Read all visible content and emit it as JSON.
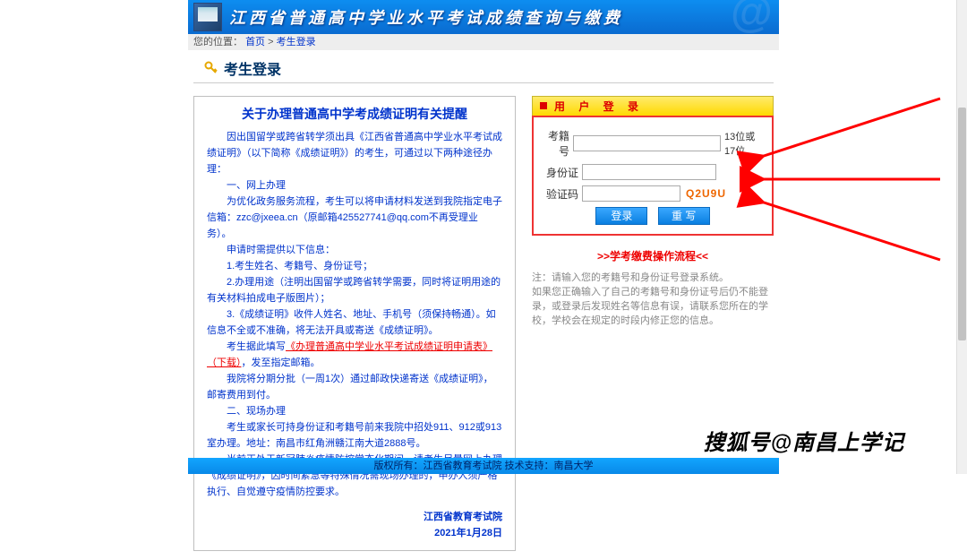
{
  "banner": {
    "title": "江西省普通高中学业水平考试成绩查询与缴费"
  },
  "breadcrumb": {
    "label": "您的位置：",
    "home": "首页",
    "sep": " > ",
    "current": "考生登录"
  },
  "page_title": "考生登录",
  "notice": {
    "heading": "关于办理普通高中学考成绩证明有关提醒",
    "p1": "因出国留学或跨省转学须出具《江西省普通高中学业水平考试成绩证明》（以下简称《成绩证明》）的考生，可通过以下两种途径办理：",
    "s1_title": "一、网上办理",
    "s1_p1_a": "为优化政务服务流程，考生可以将申请材料发送到我院指定电子信箱：",
    "s1_email": "zzc@jxeea.cn（原邮箱425527741@qq.com不再受理业务）",
    "s1_p1_b": "。",
    "s1_p2": "申请时需提供以下信息：",
    "s1_li1": "1.考生姓名、考籍号、身份证号；",
    "s1_li2": "2.办理用途（注明出国留学或跨省转学需要，同时将证明用途的有关材料拍成电子版图片）；",
    "s1_li3": "3.《成绩证明》收件人姓名、地址、手机号（须保持畅通）。如信息不全或不准确，将无法开具或寄送《成绩证明》。",
    "s1_p3_a": "考生据此填写",
    "s1_red": "《办理普通高中学业水平考试成绩证明申请表》（下载）",
    "s1_p3_b": "，发至指定邮箱。",
    "s1_p4": "我院将分期分批（一周1次）通过邮政快递寄送《成绩证明》，邮寄费用到付。",
    "s2_title": "二、现场办理",
    "s2_p1": "考生或家长可持身份证和考籍号前来我院中招处911、912或913室办理。地址：南昌市红角洲赣江南大道2888号。",
    "s2_p2": "当前正处于新冠肺炎疫情防控常态化期间，请考生尽量网上办理《成绩证明》，因时间紧急等特殊情况需现场办理的，申办人须严格执行、自觉遵守疫情防控要求。",
    "org": "江西省教育考试院",
    "date": "2021年1月28日"
  },
  "login": {
    "caption": "用 户 登 录",
    "fields": {
      "exam_no_label": "考籍号",
      "exam_no_hint": "13位或17位",
      "id_label": "身份证",
      "captcha_label": "验证码",
      "captcha_code": "Q2U9U"
    },
    "buttons": {
      "login": "登录",
      "reset": "重 写"
    }
  },
  "flow_link": ">>学考缴费操作流程<<",
  "below_note": "注：请输入您的考籍号和身份证号登录系统。\n如果您正确输入了自己的考籍号和身份证号后仍不能登录，或登录后发现姓名等信息有误，请联系您所在的学校，学校会在规定的时段内修正您的信息。",
  "footer": "版权所有：江西省教育考试院 技术支持：南昌大学",
  "watermark": "搜狐号@南昌上学记"
}
